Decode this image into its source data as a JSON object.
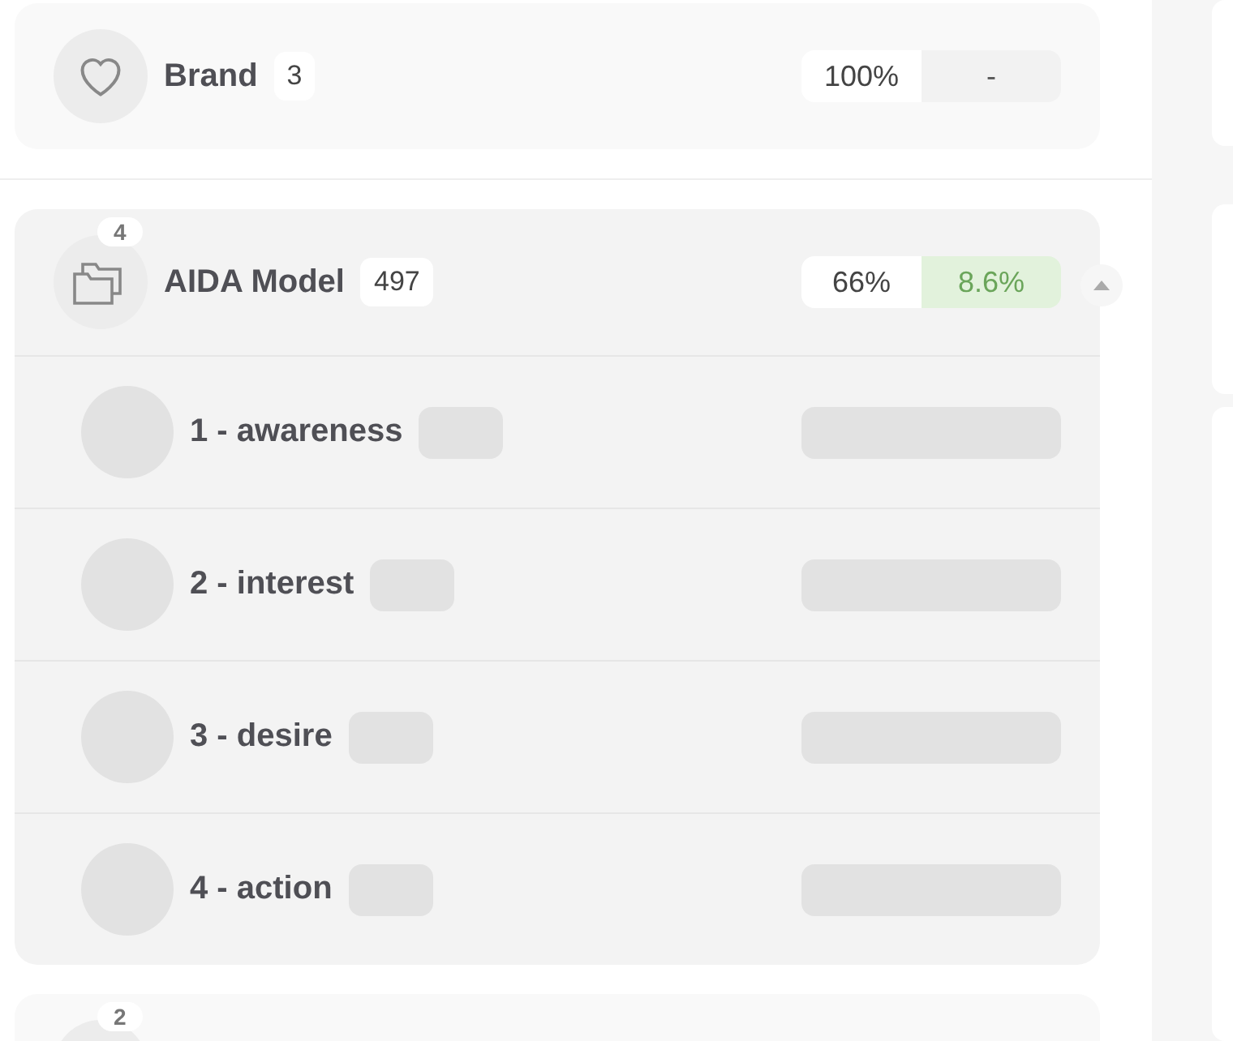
{
  "groups": [
    {
      "kind": "heart",
      "name": "Brand",
      "count": "3",
      "share": "100%",
      "change": {
        "text": "-",
        "kind": "neutral"
      },
      "expanded": false
    },
    {
      "kind": "folder",
      "badge": "4",
      "name": "AIDA Model",
      "count": "497",
      "share": "66%",
      "change": {
        "text": "8.6%",
        "kind": "positive"
      },
      "expanded": true,
      "children": [
        {
          "name": "1 - awareness",
          "loading": true
        },
        {
          "name": "2 - interest",
          "loading": true
        },
        {
          "name": "3 - desire",
          "loading": true
        },
        {
          "name": "4 - action",
          "loading": true
        }
      ]
    },
    {
      "badge": "2",
      "expanded": false
    }
  ]
}
